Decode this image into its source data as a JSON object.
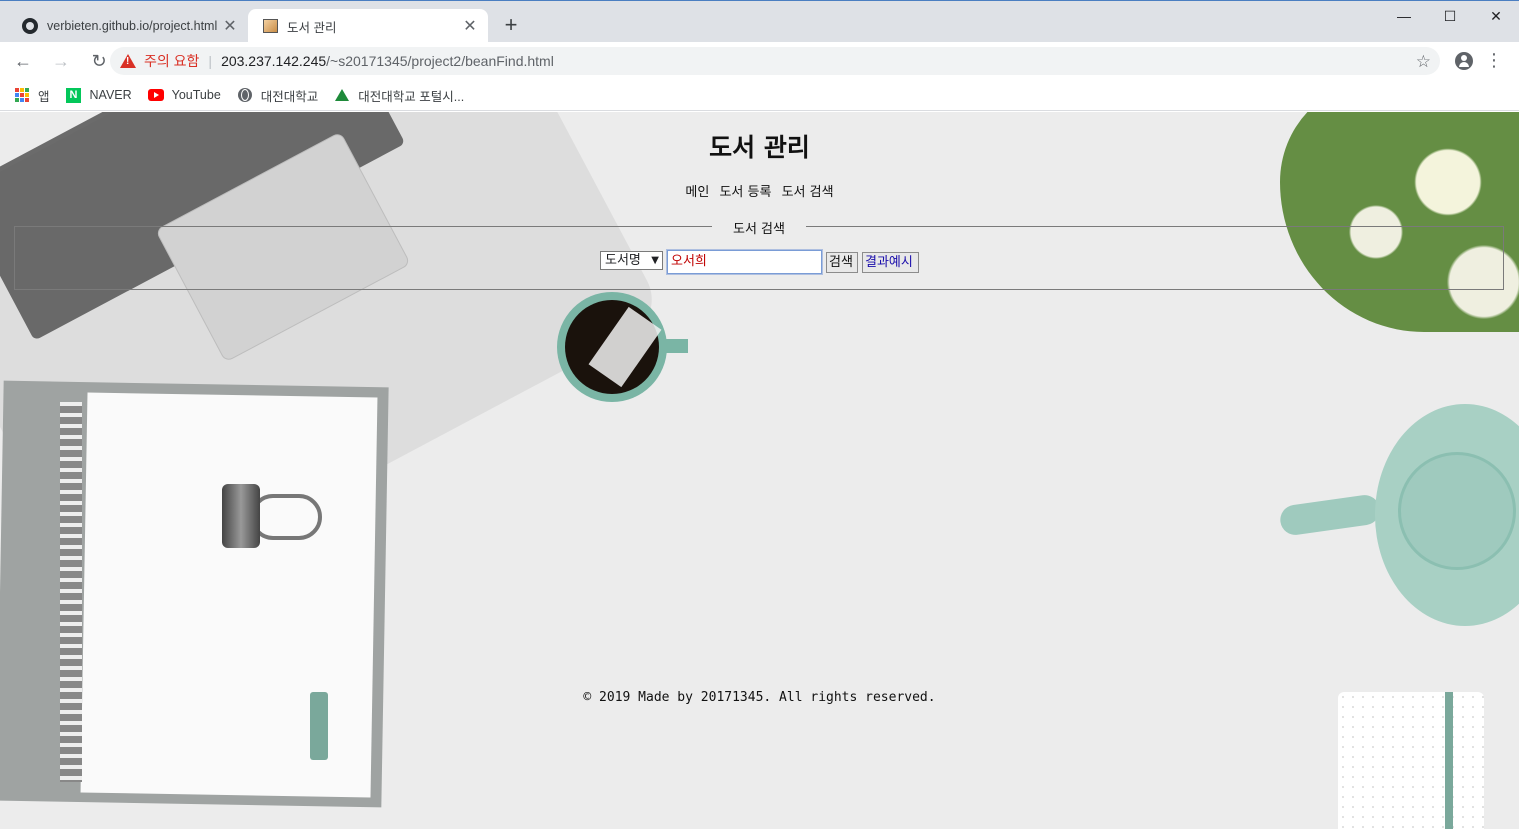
{
  "browser": {
    "tabs": [
      {
        "title": "verbieten.github.io/project.html",
        "active": false,
        "icon": "github-icon"
      },
      {
        "title": "도서 관리",
        "active": true,
        "icon": "page-favicon"
      }
    ],
    "address": {
      "security_warning": "주의 요함",
      "host": "203.237.142.245",
      "path": "/~s20171345/project2/beanFind.html"
    },
    "bookmarks": [
      {
        "label": "앱",
        "icon": "apps-icon"
      },
      {
        "label": "NAVER",
        "icon": "naver-icon"
      },
      {
        "label": "YouTube",
        "icon": "youtube-icon"
      },
      {
        "label": "대전대학교",
        "icon": "globe-icon"
      },
      {
        "label": "대전대학교 포털시...",
        "icon": "tree-icon"
      }
    ]
  },
  "page": {
    "title": "도서 관리",
    "nav": [
      "메인",
      "도서 등록",
      "도서 검색"
    ],
    "search": {
      "legend": "도서 검색",
      "select_value": "도서명",
      "input_value": "오서희",
      "search_button": "검색",
      "example_button": "결과예시"
    },
    "footer": "© 2019 Made by 20171345. All rights reserved."
  },
  "colors": {
    "warning": "#d93025",
    "input_text": "#c00000",
    "example_button_text": "#1a0dab",
    "page_background": "#ececec"
  }
}
